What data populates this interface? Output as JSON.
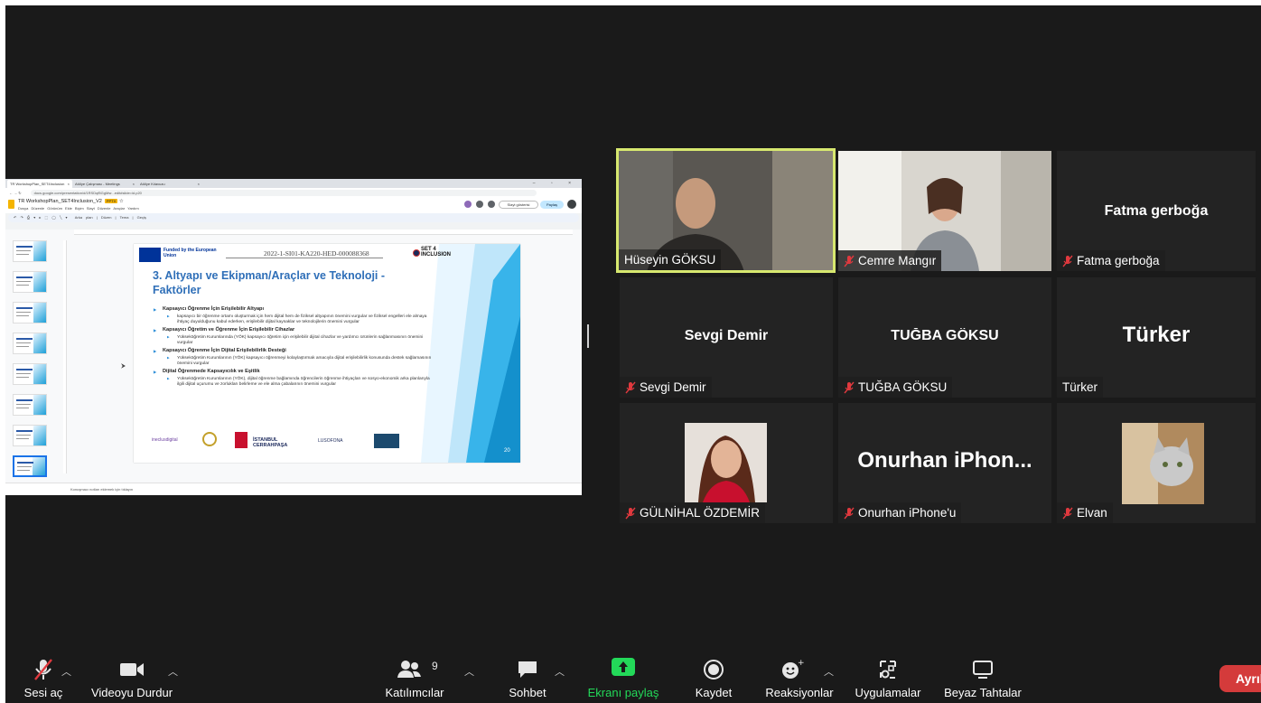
{
  "shared_screen": {
    "browser_tabs": [
      "TR WorkshopPlan_SET4Inclusion",
      "Atölye Çalışması - Meetings",
      "Atölye Kılavuzu"
    ],
    "address_bar": "docs.google.com/presentation/d/1RSDqf5GgMsr...edit#slide=id.p20",
    "doc_title": "TR WorkshopPlan_SET4Inclusion_V2",
    "doc_badge": "PPTX",
    "menu": "Dosya  Düzenle  Görünüm  Ekle  Biçim  Slayt  Düzenle  Araçlar  Yardım",
    "present_button": "Slayt gösterisi",
    "share_button": "Paylaş",
    "toolbar_text": "Arka plan  |  Düzen  |  Tema  |  Geçiş",
    "notes_placeholder": "Konuşmacı notları eklemek için tıklayın",
    "slide": {
      "funded_by": "Funded by the European Union",
      "project_code": "2022-1-SI01-KA220-HED-000088368",
      "set4": "SET 4 INCLUSION",
      "title": "3. Altyapı ve Ekipman/Araçlar ve Teknoloji - Faktörler",
      "sections": [
        {
          "heading": "Kapsayıcı Öğrenme İçin Erişilebilir Altyapı",
          "body": "kapsayıcı bir öğrenme ortamı oluşturmak için hem dijital hem de fiziksel altyapının önemini vurgular ve fiziksel engelleri ele almaya ihtiyaç duyulduğunu kabul ederken, erişilebilir dijital kaynaklar ve teknolojilerin önemini vurgular"
        },
        {
          "heading": "Kapsayıcı Öğretim ve Öğrenme İçin Erişilebilir Cihazlar",
          "body": "Yükseköğretim Kurumlarında (YÖK) kapsayıcı öğretim için erişilebilir dijital cihazlar ve yardımcı ürünlerin sağlanmasının önemini vurgular"
        },
        {
          "heading": "Kapsayıcı Öğrenme İçin Dijital Erişilebilirlik Desteği",
          "body": "Yükseköğretim Kurumlarının (YÖK) kapsayıcı öğrenmeyi kolaylaştırmak amacıyla dijital erişilebilirlik konusunda destek sağlamasının önemini vurgular"
        },
        {
          "heading": "Dijital Öğrenmede Kapsayıcılık ve Eşitlik",
          "body": "Yükseköğretim Kurumlarının (YÖK), dijital öğrenme bağlamında öğrencilerin öğrenme ihtiyaçları ve sosyo-ekonomik arka planlarıyla ilgili dijital uçurumu ve zorlukları belirleme ve ele alma çabalarının önemini vurgular"
        }
      ],
      "logos": [
        "ineclusdigital",
        "İSTANBUL CERRAHPAŞA",
        "LUSOFONA"
      ],
      "page_number": "20"
    }
  },
  "participants": [
    {
      "name": "Hüseyin GÖKSU",
      "muted": false,
      "video": true,
      "active": true
    },
    {
      "name": "Cemre Mangır",
      "muted": true,
      "video": true,
      "active": false
    },
    {
      "name": "Fatma gerboğa",
      "big": "Fatma gerboğa",
      "muted": true,
      "video": false
    },
    {
      "name": "Sevgi Demir",
      "big": "Sevgi Demir",
      "muted": true,
      "video": false
    },
    {
      "name": "TUĞBA GÖKSU",
      "big": "TUĞBA GÖKSU",
      "muted": true,
      "video": false
    },
    {
      "name": "Türker",
      "big": "Türker",
      "muted": false,
      "video": false
    },
    {
      "name": "GÜLNİHAL ÖZDEMİR",
      "muted": true,
      "video": false,
      "photo": true
    },
    {
      "name": "Onurhan iPhone'u",
      "big": "Onurhan iPhon...",
      "muted": true,
      "video": false
    },
    {
      "name": "Elvan",
      "muted": true,
      "video": false,
      "photo": true
    }
  ],
  "toolbar": {
    "unmute": "Sesi aç",
    "stop_video": "Videoyu Durdur",
    "participants": "Katılımcılar",
    "participants_count": "9",
    "chat": "Sohbet",
    "share_screen": "Ekranı paylaş",
    "record": "Kaydet",
    "reactions": "Reaksiyonlar",
    "apps": "Uygulamalar",
    "whiteboards": "Beyaz Tahtalar",
    "end": "Ayrıl"
  },
  "colors": {
    "background": "#1a1a1a",
    "tile": "#232323",
    "active_speaker_border": "#d7e86f",
    "mute_icon": "#e0393e",
    "share_green": "#23d959",
    "end_button": "#d43b3b",
    "slide_title": "#2f6fb8"
  }
}
